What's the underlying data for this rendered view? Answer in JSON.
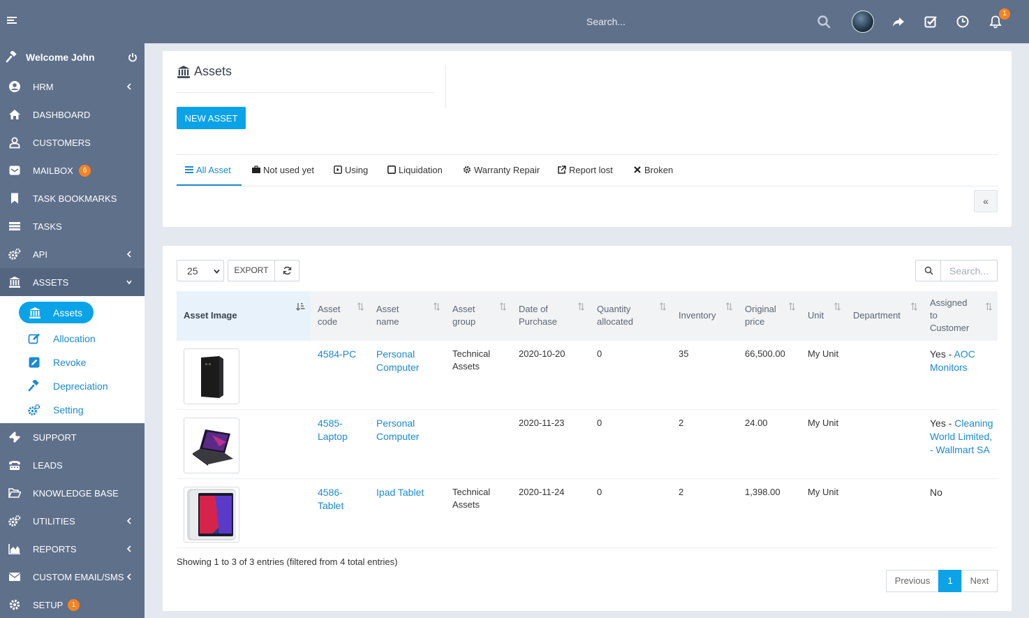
{
  "header": {
    "search_placeholder": "Search...",
    "notifications_count": "1"
  },
  "sidebar": {
    "welcome": "Welcome John",
    "items": [
      {
        "label": "HRM",
        "icon": "user-circle-icon"
      },
      {
        "label": "DASHBOARD",
        "icon": "home-icon"
      },
      {
        "label": "CUSTOMERS",
        "icon": "user-icon"
      },
      {
        "label": "MAILBOX",
        "icon": "envelope-icon",
        "badge": "6"
      },
      {
        "label": "TASK BOOKMARKS",
        "icon": "bookmark-icon"
      },
      {
        "label": "TASKS",
        "icon": "tasks-icon"
      },
      {
        "label": "API",
        "icon": "cogs-icon"
      },
      {
        "label": "ASSETS",
        "icon": "bank-icon"
      },
      {
        "label": "SUPPORT",
        "icon": "ticket-icon"
      },
      {
        "label": "LEADS",
        "icon": "tty-icon"
      },
      {
        "label": "KNOWLEDGE BASE",
        "icon": "folder-open-icon"
      },
      {
        "label": "UTILITIES",
        "icon": "cogs-icon"
      },
      {
        "label": "REPORTS",
        "icon": "area-chart-icon"
      },
      {
        "label": "CUSTOM EMAIL/SMS",
        "icon": "envelope-icon"
      },
      {
        "label": "SETUP",
        "icon": "gear-icon",
        "badge": "1"
      }
    ],
    "submenu": [
      {
        "label": "Assets",
        "icon": "bank-icon"
      },
      {
        "label": "Allocation",
        "icon": "edit-icon"
      },
      {
        "label": "Revoke",
        "icon": "pencil-square-icon"
      },
      {
        "label": "Depreciation",
        "icon": "gavel-icon"
      },
      {
        "label": "Setting",
        "icon": "cogs-icon"
      }
    ]
  },
  "page": {
    "title": "Assets",
    "new_button": "NEW ASSET",
    "tabs": [
      {
        "label": "All Asset",
        "icon": "list-icon"
      },
      {
        "label": "Not used yet",
        "icon": "briefcase-icon"
      },
      {
        "label": "Using",
        "icon": "play-square-icon"
      },
      {
        "label": "Liquidation",
        "icon": "square-icon"
      },
      {
        "label": "Warranty Repair",
        "icon": "gear-icon"
      },
      {
        "label": "Report lost",
        "icon": "external-link-icon"
      },
      {
        "label": "Broken",
        "icon": "times-icon"
      }
    ],
    "collapse_label": "«"
  },
  "table_controls": {
    "page_length": "25",
    "export_label": "EXPORT",
    "search_placeholder": "Search..."
  },
  "table": {
    "columns": [
      [
        "Asset Image"
      ],
      [
        "Asset",
        "code"
      ],
      [
        "Asset",
        "name"
      ],
      [
        "Asset",
        "group"
      ],
      [
        "Date of",
        "Purchase"
      ],
      [
        "Quantity",
        "allocated"
      ],
      [
        "Inventory"
      ],
      [
        "Original",
        "price"
      ],
      [
        "Unit"
      ],
      [
        "Department"
      ],
      [
        "Assigned",
        "to",
        "Customer"
      ]
    ],
    "rows": [
      {
        "image": "desktop-pc-image",
        "code": [
          "4584-PC"
        ],
        "name": [
          "Personal",
          "Computer"
        ],
        "group": [
          "Technical",
          "Assets"
        ],
        "date": "2020-10-20",
        "qty": "0",
        "inventory": "35",
        "price": "66,500.00",
        "unit": "My Unit",
        "department": "",
        "assigned_prefix": "Yes - ",
        "assigned_links": [
          "AOC",
          "Monitors"
        ]
      },
      {
        "image": "laptop-image",
        "code": [
          "4585-",
          "Laptop"
        ],
        "name": [
          "Personal",
          "Computer"
        ],
        "group": [],
        "date": "2020-11-23",
        "qty": "0",
        "inventory": "2",
        "price": "24.00",
        "unit": "My Unit",
        "department": "",
        "assigned_prefix": "Yes - ",
        "assigned_links": [
          "Cleaning",
          "World Limited,",
          "- Wallmart SA"
        ]
      },
      {
        "image": "tablet-image",
        "code": [
          "4586-",
          "Tablet"
        ],
        "name": [
          "Ipad Tablet"
        ],
        "group": [
          "Technical",
          "Assets"
        ],
        "date": "2020-11-24",
        "qty": "0",
        "inventory": "2",
        "price": "1,398.00",
        "unit": "My Unit",
        "department": "",
        "assigned_prefix": "No",
        "assigned_links": []
      }
    ]
  },
  "footer": {
    "info": "Showing 1 to 3 of 3 entries (filtered from 4 total entries)",
    "previous": "Previous",
    "current_page": "1",
    "next": "Next"
  },
  "colors": {
    "sidebar_bg": "#5f708a",
    "accent": "#0aa3e8",
    "link": "#1a8ad2",
    "badge": "#f58321"
  }
}
